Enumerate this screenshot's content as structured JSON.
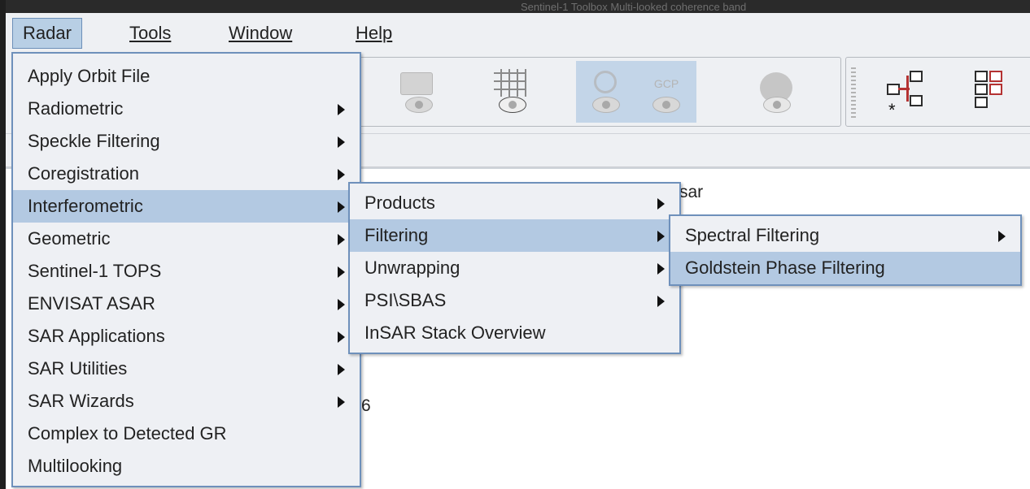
{
  "window": {
    "title": "Sentinel-1 Toolbox Multi-looked coherence band"
  },
  "menubar": {
    "radar": "Radar",
    "tools": "Tools",
    "window": "Window",
    "help": "Help"
  },
  "toolbar": {
    "gcp_label": "GCP"
  },
  "background_text": {
    "tab_fragment": "sar",
    "number_fragment": "6"
  },
  "radar_menu": {
    "items": [
      {
        "label": "Apply Orbit File",
        "submenu": false
      },
      {
        "label": "Radiometric",
        "submenu": true
      },
      {
        "label": "Speckle Filtering",
        "submenu": true
      },
      {
        "label": "Coregistration",
        "submenu": true
      },
      {
        "label": "Interferometric",
        "submenu": true,
        "highlighted": true
      },
      {
        "label": "Geometric",
        "submenu": true
      },
      {
        "label": "Sentinel-1 TOPS",
        "submenu": true
      },
      {
        "label": "ENVISAT ASAR",
        "submenu": true
      },
      {
        "label": "SAR Applications",
        "submenu": true
      },
      {
        "label": "SAR Utilities",
        "submenu": true
      },
      {
        "label": "SAR Wizards",
        "submenu": true
      },
      {
        "label": "Complex to Detected GR",
        "submenu": false
      },
      {
        "label": "Multilooking",
        "submenu": false
      }
    ]
  },
  "interferometric_menu": {
    "items": [
      {
        "label": "Products",
        "submenu": true
      },
      {
        "label": "Filtering",
        "submenu": true,
        "highlighted": true
      },
      {
        "label": "Unwrapping",
        "submenu": true
      },
      {
        "label": "PSI\\SBAS",
        "submenu": true
      },
      {
        "label": "InSAR Stack Overview",
        "submenu": false
      }
    ]
  },
  "filtering_menu": {
    "items": [
      {
        "label": "Spectral Filtering",
        "submenu": true
      },
      {
        "label": "Goldstein Phase Filtering",
        "submenu": false,
        "highlighted": true
      }
    ]
  },
  "colors": {
    "highlight": "#b3c9e2",
    "menu_border": "#6e90bb",
    "menu_bg": "#eef0f4"
  }
}
